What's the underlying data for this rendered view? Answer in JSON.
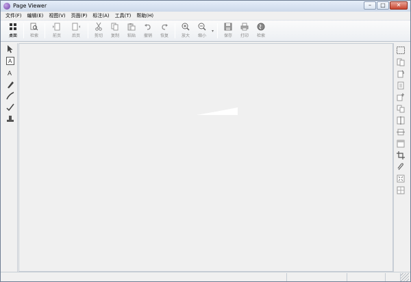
{
  "window": {
    "title": "Page Viewer"
  },
  "menu": [
    {
      "label": "文件(F)"
    },
    {
      "label": "编辑(E)"
    },
    {
      "label": "视图(V)"
    },
    {
      "label": "页面(P)"
    },
    {
      "label": "标注(A)"
    },
    {
      "label": "工具(T)"
    },
    {
      "label": "帮助(H)"
    }
  ],
  "toolbar": {
    "desktop": "桌面",
    "search": "检索",
    "prev_page": "前页",
    "next_page": "后页",
    "cut": "剪切",
    "copy": "复制",
    "paste": "粘贴",
    "undo": "撤销",
    "redo": "恢复",
    "zoom_in": "放大",
    "zoom_out": "缩小",
    "save": "保存",
    "print": "打印",
    "upload": "检索"
  },
  "left_tools": [
    "select-arrow-icon",
    "text-box-icon",
    "text-icon",
    "highlighter-icon",
    "pen-icon",
    "checkmark-pen-icon",
    "stamp-icon"
  ],
  "right_tools": [
    "select-rect-icon",
    "page-layout-icon",
    "rotate-page-icon",
    "page-list-icon",
    "add-page-icon",
    "copy-page-icon",
    "split-page-icon",
    "crop-page-icon",
    "header-footer-icon",
    "crop-icon",
    "attach-icon",
    "fit-page-icon",
    "grid-icon"
  ],
  "colors": {
    "title_bar": "#dbe5f2",
    "accent": "#6b3fa6",
    "close_button": "#c9452e"
  }
}
